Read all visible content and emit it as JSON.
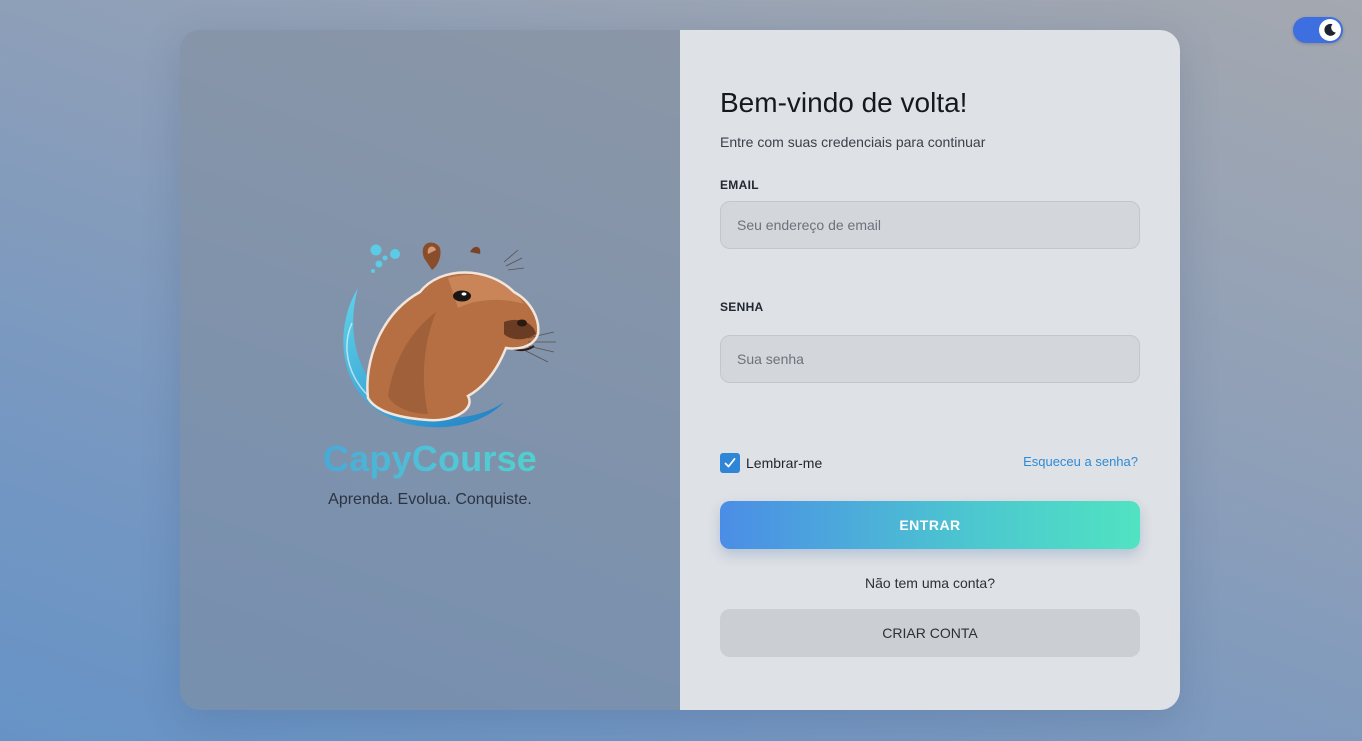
{
  "theme_toggle": {
    "icon": "moon-icon",
    "state": "dark-mode-toggle"
  },
  "brand": {
    "name": "CapyCourse",
    "tagline": "Aprenda. Evolua. Conquiste.",
    "logo_icon": "capybara-logo-icon"
  },
  "login": {
    "title": "Bem-vindo de volta!",
    "subtitle": "Entre com suas credenciais para continuar",
    "email_label": "EMAIL",
    "email_placeholder": "Seu endereço de email",
    "email_value": "",
    "password_label": "SENHA",
    "password_placeholder": "Sua senha",
    "password_value": "",
    "remember_label": "Lembrar-me",
    "remember_checked": true,
    "forgot_link": "Esqueceu a senha?",
    "submit_label": "ENTRAR",
    "no_account_text": "Não tem uma conta?",
    "create_account_label": "CRIAR CONTA"
  },
  "colors": {
    "accent_start": "#4b8de6",
    "accent_end": "#50e3c2",
    "toggle": "#3d6fe0",
    "link": "#2e8bd5"
  }
}
